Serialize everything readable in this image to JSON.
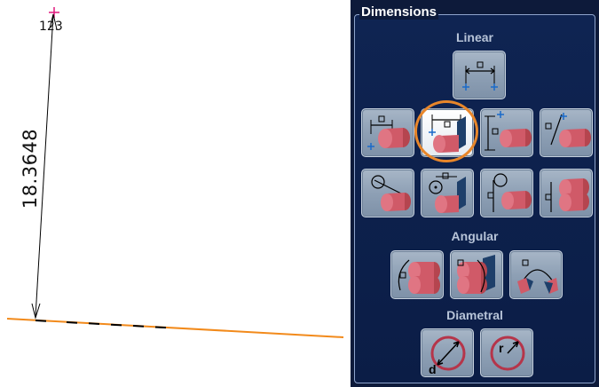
{
  "canvas": {
    "point_label": "123",
    "dimension_value": "18.3648",
    "colors": {
      "point_marker": "#e0187d",
      "edge_line": "#f28a1b",
      "dimension_line": "#000000"
    }
  },
  "panel": {
    "title": "Dimensions",
    "sections": {
      "linear": "Linear",
      "angular": "Angular",
      "diametral": "Diametral"
    },
    "tools": [
      {
        "name": "linear-horizontal-points",
        "icon": "horizontal-dimension-points-icon"
      },
      {
        "name": "linear-horizontal-cylinder",
        "icon": "horizontal-dimension-cylinder-icon"
      },
      {
        "name": "linear-horizontal-plane",
        "icon": "horizontal-dimension-plane-icon",
        "active": true
      },
      {
        "name": "linear-vertical-cylinder",
        "icon": "vertical-dimension-cylinder-icon"
      },
      {
        "name": "linear-oblique-cylinder",
        "icon": "oblique-dimension-cylinder-icon"
      },
      {
        "name": "linear-circle-cylinder",
        "icon": "circle-dimension-cylinder-icon"
      },
      {
        "name": "linear-circle-plane",
        "icon": "circle-dimension-plane-icon"
      },
      {
        "name": "linear-circle-vertical",
        "icon": "circle-vertical-dimension-icon"
      },
      {
        "name": "linear-double-cylinder",
        "icon": "double-cylinder-dimension-icon"
      },
      {
        "name": "angular-cylinders",
        "icon": "angular-cylinders-icon"
      },
      {
        "name": "angular-plane",
        "icon": "angular-plane-icon"
      },
      {
        "name": "angular-arc",
        "icon": "angular-arc-icon"
      },
      {
        "name": "diameter",
        "icon": "diameter-icon",
        "glyph": "d"
      },
      {
        "name": "radius",
        "icon": "radius-icon",
        "glyph": "r"
      }
    ],
    "colors": {
      "accent_ring": "#e8862a",
      "panel_bg": "#0d1a3a",
      "cylinder": "#d05a68"
    }
  }
}
